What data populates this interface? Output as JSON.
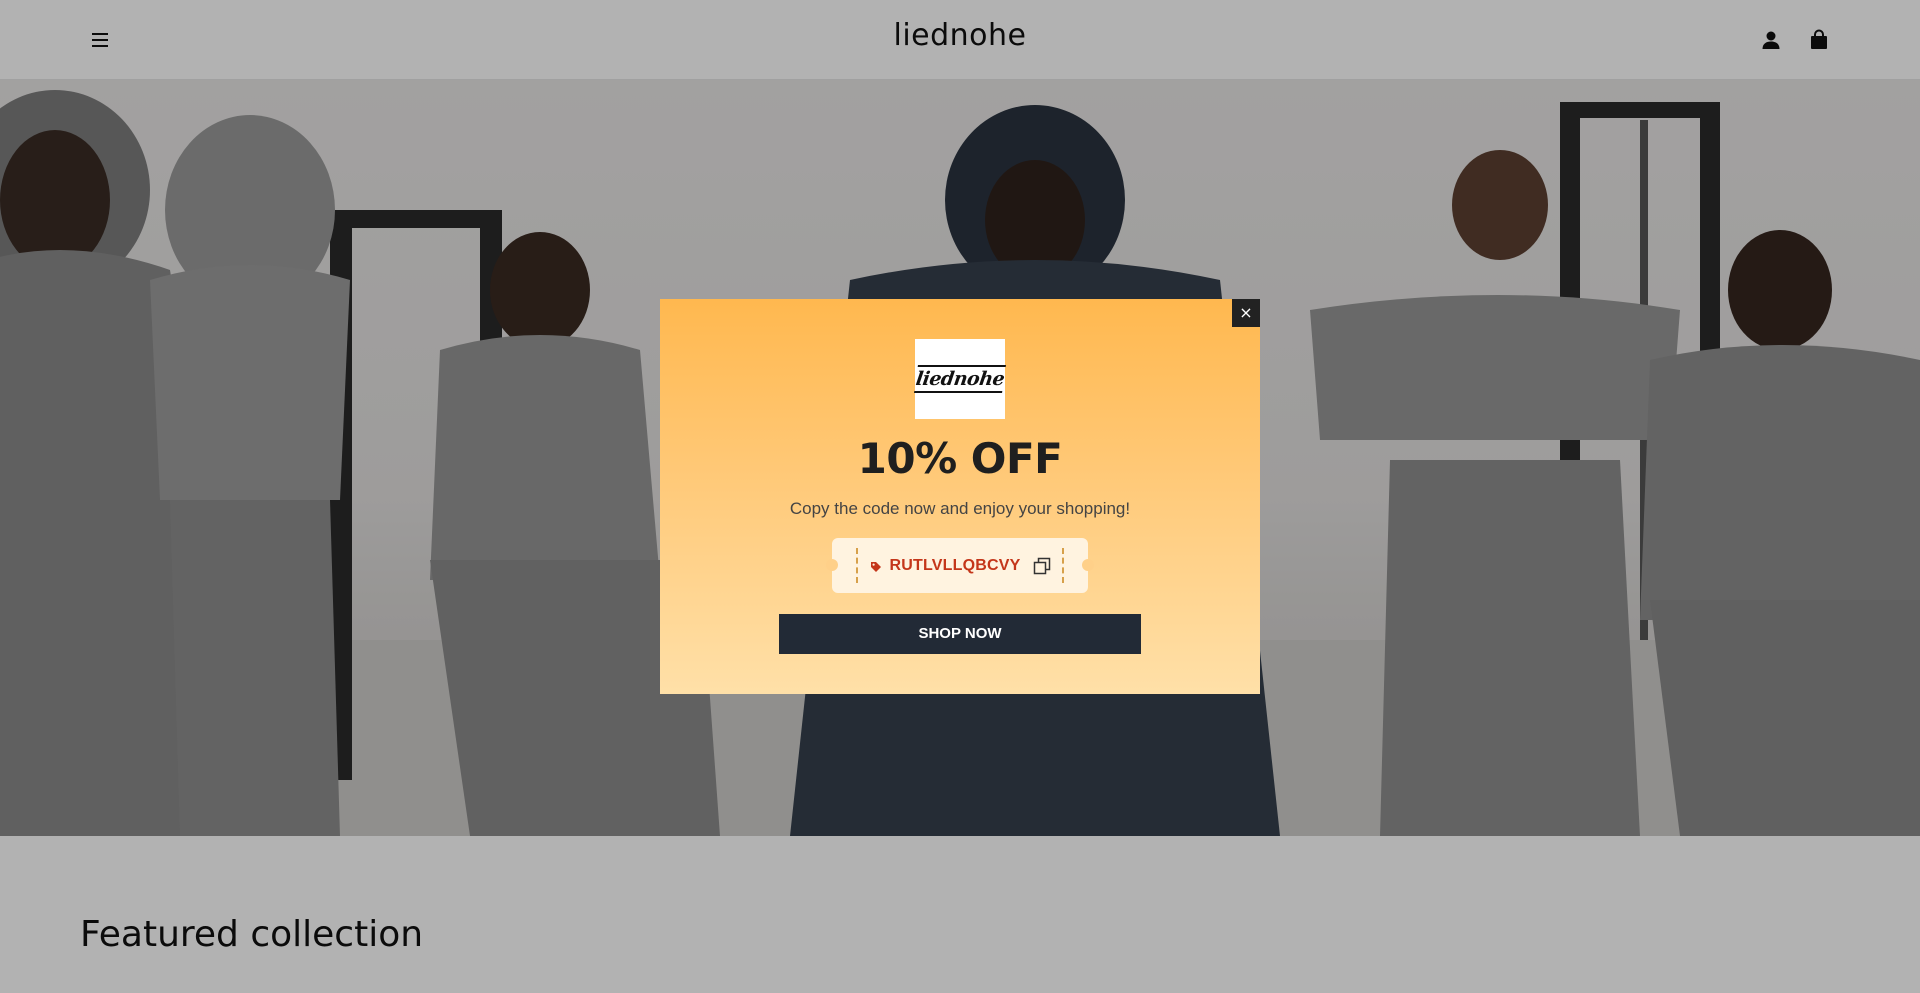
{
  "header": {
    "brand": "liednohe",
    "menu_icon": "hamburger-menu-icon",
    "account_icon": "account-icon",
    "cart_icon": "shopping-bag-icon"
  },
  "featured": {
    "title": "Featured collection"
  },
  "popup": {
    "close_label": "×",
    "logo_text": "liednohe",
    "headline": "10% OFF",
    "subtitle": "Copy the code now and enjoy your shopping!",
    "coupon_code": "RUTLVLLQBCVY",
    "tag_icon": "price-tag-icon",
    "copy_icon": "copy-icon",
    "cta_label": "SHOP NOW"
  },
  "colors": {
    "popup_gradient_top": "#ffb84f",
    "popup_gradient_bottom": "#ffe0a8",
    "coupon_code": "#c4361a",
    "button_bg": "#222a36"
  }
}
